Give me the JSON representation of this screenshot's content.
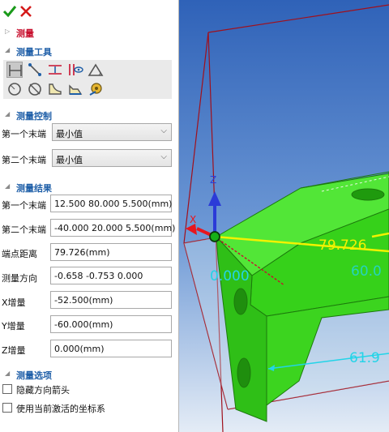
{
  "panel": {
    "section_measure": "测量",
    "section_tools": "测量工具",
    "section_control": "测量控制",
    "section_results": "测量结果",
    "section_options": "测量选项"
  },
  "tools": {
    "row1": [
      "distance-tool-icon",
      "point-to-line-icon",
      "min-distance-icon",
      "visibility-distance-icon",
      "angle-tool-icon"
    ],
    "row2": [
      "circle-measure-icon",
      "diameter-measure-icon",
      "area-measure-icon",
      "edge-measure-icon",
      "tape-measure-icon"
    ]
  },
  "control": {
    "first_end_label": "第一个末端",
    "first_end_value": "最小值",
    "second_end_label": "第二个末端",
    "second_end_value": "最小值"
  },
  "results": {
    "first_end_label": "第一个末端",
    "first_end_value": "12.500  80.000  5.500(mm)",
    "second_end_label": "第二个末端",
    "second_end_value": "-40.000  20.000  5.500(mm)",
    "distance_label": "端点距离",
    "distance_value": "79.726(mm)",
    "direction_label": "测量方向",
    "direction_value": "-0.658  -0.753  0.000",
    "dx_label": "X增量",
    "dx_value": "-52.500(mm)",
    "dy_label": "Y增量",
    "dy_value": "-60.000(mm)",
    "dz_label": "Z增量",
    "dz_value": "0.000(mm)"
  },
  "options": {
    "hide_arrow_label": "隐藏方向箭头",
    "use_active_cs_label": "使用当前激活的坐标系",
    "hide_arrow_checked": false,
    "use_active_cs_checked": false
  },
  "viewport": {
    "dist_label": "79.726",
    "dz_label": "0.000",
    "dy_label": "60.0",
    "dx_label": "61.9",
    "axis_z": "Z",
    "axis_x": "X",
    "colors": {
      "part": "#3ddc1a",
      "sky": "#3a78d0",
      "distance": "#f2f200",
      "delta": "#22d4e8",
      "frame": "#a0101c"
    }
  }
}
